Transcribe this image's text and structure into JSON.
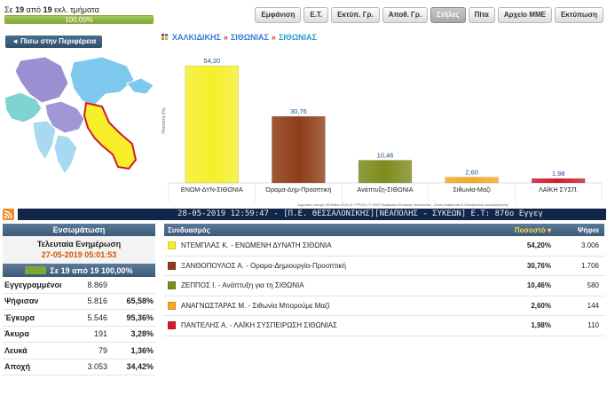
{
  "progress": {
    "prefix": "Σε",
    "done": "19",
    "from": "από",
    "total": "19",
    "suffix": "εκλ. τμήματα",
    "percent_label": "100,00%",
    "fraction": 1.0
  },
  "toolbar": [
    {
      "label": "Εμφάνιση",
      "active": false
    },
    {
      "label": "Ε.Τ.",
      "active": false
    },
    {
      "label": "Εκτύπ. Γρ.",
      "active": false
    },
    {
      "label": "Αποθ. Γρ.",
      "active": false
    },
    {
      "label": "Στήλες",
      "active": true
    },
    {
      "label": "Πίτα",
      "active": false
    },
    {
      "label": "Αρχείο ΜΜΕ",
      "active": false
    },
    {
      "label": "Εκτύπωση",
      "active": false
    }
  ],
  "back_button": "◄ Πίσω στην Περιφέρεια",
  "breadcrumb": {
    "items": [
      "ΧΑΛΚΙΔΙΚΗΣ",
      "ΣΙΘΩΝΙΑΣ",
      "ΣΙΘΩΝΙΑΣ"
    ],
    "separator": "»"
  },
  "chart_data": {
    "type": "bar",
    "categories": [
      "ΕΝΩΜ-ΔΥΝ-ΣΙΘΩΝΙΑ",
      "Όραμα-Δημ-Προοπτική",
      "Ανάπτυξη-ΣΙΘΩΝΙΑ",
      "Σιθωνία-Μαζί",
      "ΛΑΪΚΗ ΣΥΣΠ."
    ],
    "values": [
      54.2,
      30.76,
      10.46,
      2.6,
      1.98
    ],
    "value_labels": [
      "54,20",
      "30,76",
      "10,46",
      "2,60",
      "1,98"
    ],
    "colors": [
      "#f5ef2a",
      "#8e3d17",
      "#7e8b1c",
      "#f7a91e",
      "#d11a2e"
    ],
    "ylabel": "Ποσοστό (%)",
    "ylim": [
      0,
      60
    ],
    "footer": "Δημοτικές εκλογές 26 Μαΐου 2019 (Α' ΓΥΡΟΣ) / © 2019 Περιφέρεια Κεντρικής Μακεδονίας - Δ/νση Διαφάνειας & Ηλεκτρονικής Διακυβέρνησης"
  },
  "ticker": "28-05-2019 12:59:47 - [Π.Ε. ΘΕΣΣΑΛΟΝΙΚΗΣ][ΝΕΑΠΟΛΗΣ - ΣΥΚΕΩΝ] Ε.Τ: 876ο Εγγεγ",
  "summary": {
    "header": "Ενσωμάτωση",
    "update_label": "Τελευταία Ενημέρωση",
    "update_date": "27-05-2019 05:01:53",
    "sections_text": "Σε 19 από 19 100,00%",
    "rows": [
      {
        "label": "Εγγεγραμμένοι",
        "value": "8.869",
        "pct": ""
      },
      {
        "label": "Ψήφισαν",
        "value": "5.816",
        "pct": "65,58%"
      },
      {
        "label": "Έγκυρα",
        "value": "5.546",
        "pct": "95,36%"
      },
      {
        "label": "Άκυρα",
        "value": "191",
        "pct": "3,28%"
      },
      {
        "label": "Λευκά",
        "value": "79",
        "pct": "1,36%"
      },
      {
        "label": "Αποχή",
        "value": "3.053",
        "pct": "34,42%"
      }
    ]
  },
  "results": {
    "head_name": "Συνδυασμός",
    "head_pct": "Ποσοστό ▾",
    "head_votes": "Ψήφοι",
    "rows": [
      {
        "name": "ΝΤΕΜΠΛΑΣ Κ. - ΕΝΩΜΕΝΗ ΔΥΝΑΤΗ ΣΙΘΩΝΙΑ",
        "pct": "54,20%",
        "votes": "3.006",
        "color": "#f5ef2a"
      },
      {
        "name": "ΞΑΝΘΟΠΟΥΛΟΣ Α. - Οραμα-Δημιουργία-Προοπτική",
        "pct": "30,76%",
        "votes": "1.706",
        "color": "#8e3d17"
      },
      {
        "name": "ΖΕΠΠΟΣ Ι. - Ανάπτυξη για τη ΣΙΘΩΝΙΑ",
        "pct": "10,46%",
        "votes": "580",
        "color": "#7e8b1c"
      },
      {
        "name": "ΑΝΑΓΝΩΣΤΑΡΑΣ Μ. - Σιθωνία Μπορούμε Μαζί",
        "pct": "2,60%",
        "votes": "144",
        "color": "#f7a91e"
      },
      {
        "name": "ΠΑΝΤΕΛΗΣ Α. - ΛΑΪΚΗ ΣΥΣΠΕΙΡΩΣΗ ΣΙΘΩΝΙΑΣ",
        "pct": "1,98%",
        "votes": "110",
        "color": "#d11a2e"
      }
    ]
  }
}
